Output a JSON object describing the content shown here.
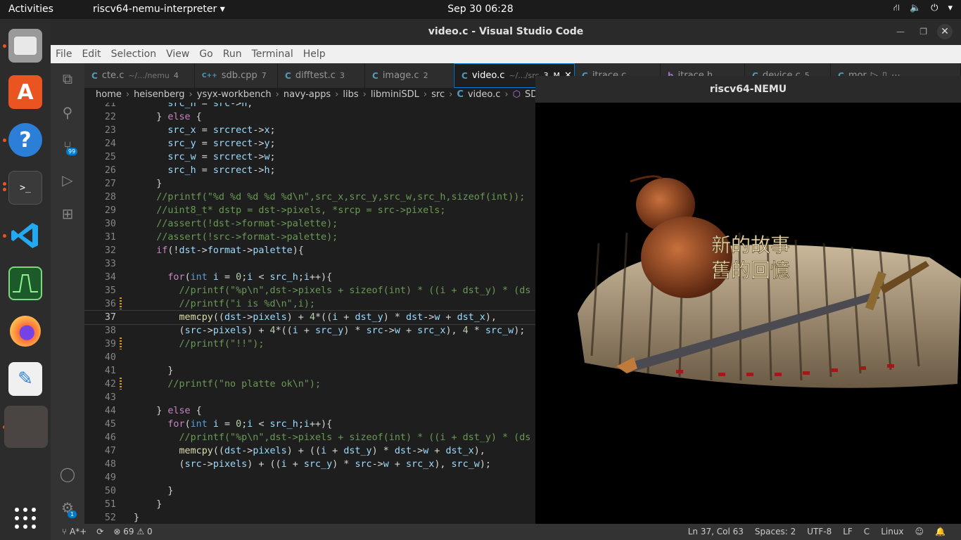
{
  "topbar": {
    "activities": "Activities",
    "app_menu": "riscv64-nemu-interpreter",
    "clock": "Sep 30  06:28"
  },
  "vscode": {
    "window_title": "video.c - Visual Studio Code",
    "menu": [
      "File",
      "Edit",
      "Selection",
      "View",
      "Go",
      "Run",
      "Terminal",
      "Help"
    ],
    "tabs": [
      {
        "icon": "C",
        "name": "cte.c",
        "path": "~/.../nemu",
        "badge": "4"
      },
      {
        "icon": "C++",
        "name": "sdb.cpp",
        "path": "",
        "badge": "7"
      },
      {
        "icon": "C",
        "name": "difftest.c",
        "path": "",
        "badge": "3"
      },
      {
        "icon": "C",
        "name": "image.c",
        "path": "",
        "badge": "2"
      },
      {
        "icon": "C",
        "name": "video.c",
        "path": "~/.../src",
        "badge": "3, M"
      },
      {
        "icon": "C",
        "name": "itrace.c",
        "path": "",
        "badge": ""
      },
      {
        "icon": "h",
        "name": "itrace.h",
        "path": "",
        "badge": ""
      },
      {
        "icon": "C",
        "name": "device.c",
        "path": "",
        "badge": "5"
      },
      {
        "icon": "C",
        "name": "mor",
        "path": "",
        "badge": ""
      }
    ],
    "breadcrumb": [
      "home",
      "heisenberg",
      "ysyx-workbench",
      "navy-apps",
      "libs",
      "libminiSDL",
      "src",
      "video.c",
      "SDL_BlitSu"
    ],
    "scm_badge": "99",
    "settings_badge": "1",
    "current_line": "37",
    "code_lines": [
      {
        "n": "21",
        "html": "      <span class='var'>src_h</span> = <span class='var'>src</span>-><span class='var'>h</span>;"
      },
      {
        "n": "22",
        "html": "    } <span class='kw'>else</span> {"
      },
      {
        "n": "23",
        "html": "      <span class='var'>src_x</span> = <span class='var'>srcrect</span>-><span class='var'>x</span>;"
      },
      {
        "n": "24",
        "html": "      <span class='var'>src_y</span> = <span class='var'>srcrect</span>-><span class='var'>y</span>;"
      },
      {
        "n": "25",
        "html": "      <span class='var'>src_w</span> = <span class='var'>srcrect</span>-><span class='var'>w</span>;"
      },
      {
        "n": "26",
        "html": "      <span class='var'>src_h</span> = <span class='var'>srcrect</span>-><span class='var'>h</span>;"
      },
      {
        "n": "27",
        "html": "    }"
      },
      {
        "n": "28",
        "html": "    <span class='cm'>//printf(\"%d %d %d %d %d\\n\",src_x,src_y,src_w,src_h,sizeof(int));</span>"
      },
      {
        "n": "29",
        "html": "    <span class='cm'>//uint8_t* dstp = dst->pixels, *srcp = src->pixels;</span>"
      },
      {
        "n": "30",
        "html": "    <span class='cm'>//assert(!dst->format->palette);</span>"
      },
      {
        "n": "31",
        "html": "    <span class='cm'>//assert(!src->format->palette);</span>"
      },
      {
        "n": "32",
        "html": "    <span class='kw'>if</span>(!<span class='var'>dst</span>-><span class='var'>format</span>-><span class='var'>palette</span>){"
      },
      {
        "n": "33",
        "html": ""
      },
      {
        "n": "34",
        "html": "      <span class='kw'>for</span>(<span class='kt'>int</span> <span class='var'>i</span> = <span class='num'>0</span>;<span class='var'>i</span> < <span class='var'>src_h</span>;<span class='var'>i</span>++){"
      },
      {
        "n": "35",
        "html": "        <span class='cm'>//printf(\"%p\\n\",dst->pixels + sizeof(int) * ((i + dst_y) * (ds</span>"
      },
      {
        "n": "36",
        "html": "        <span class='cm'>//printf(\"i is %d\\n\",i);</span>"
      },
      {
        "n": "37",
        "html": "        <span class='fn'>memcpy</span>((<span class='var'>dst</span>-><span class='var'>pixels</span>) + <span class='num'>4</span>*((<span class='var'>i</span> + <span class='var'>dst_y</span>) * <span class='var'>dst</span>-><span class='var'>w</span> + <span class='var'>dst_x</span>),"
      },
      {
        "n": "38",
        "html": "        (<span class='var'>src</span>-><span class='var'>pixels</span>) + <span class='num'>4</span>*((<span class='var'>i</span> + <span class='var'>src_y</span>) * <span class='var'>src</span>-><span class='var'>w</span> + <span class='var'>src_x</span>), <span class='num'>4</span> * <span class='var'>src_w</span>);"
      },
      {
        "n": "39",
        "html": "        <span class='cm'>//printf(\"!!\");</span>"
      },
      {
        "n": "40",
        "html": ""
      },
      {
        "n": "41",
        "html": "      }"
      },
      {
        "n": "42",
        "html": "      <span class='cm'>//printf(\"no platte ok\\n\");</span>"
      },
      {
        "n": "43",
        "html": ""
      },
      {
        "n": "44",
        "html": "    } <span class='kw'>else</span> {"
      },
      {
        "n": "45",
        "html": "      <span class='kw'>for</span>(<span class='kt'>int</span> <span class='var'>i</span> = <span class='num'>0</span>;<span class='var'>i</span> < <span class='var'>src_h</span>;<span class='var'>i</span>++){"
      },
      {
        "n": "46",
        "html": "        <span class='cm'>//printf(\"%p\\n\",dst->pixels + sizeof(int) * ((i + dst_y) * (ds</span>"
      },
      {
        "n": "47",
        "html": "        <span class='fn'>memcpy</span>((<span class='var'>dst</span>-><span class='var'>pixels</span>) + ((<span class='var'>i</span> + <span class='var'>dst_y</span>) * <span class='var'>dst</span>-><span class='var'>w</span> + <span class='var'>dst_x</span>),"
      },
      {
        "n": "48",
        "html": "        (<span class='var'>src</span>-><span class='var'>pixels</span>) + ((<span class='var'>i</span> + <span class='var'>src_y</span>) * <span class='var'>src</span>-><span class='var'>w</span> + <span class='var'>src_x</span>), <span class='var'>src_w</span>);"
      },
      {
        "n": "49",
        "html": ""
      },
      {
        "n": "50",
        "html": "      }"
      },
      {
        "n": "51",
        "html": "    }"
      },
      {
        "n": "52",
        "html": "}"
      }
    ],
    "status": {
      "branch": "A*+",
      "errors": "69",
      "warnings": "0",
      "position": "Ln 37, Col 63",
      "spaces": "Spaces: 2",
      "encoding": "UTF-8",
      "eol": "LF",
      "language": "C",
      "os": "Linux"
    }
  },
  "nemu": {
    "title": "riscv64-NEMU",
    "game_text_line1": "新的故事",
    "game_text_line2": "舊的回憶"
  }
}
